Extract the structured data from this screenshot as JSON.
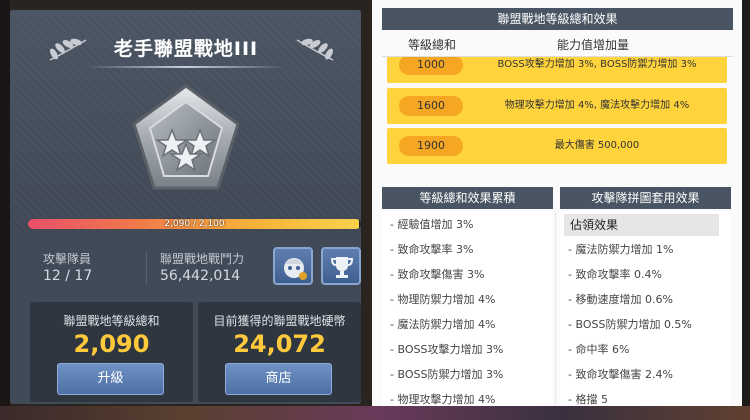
{
  "left_panel": {
    "title": "老手聯盟戰地III",
    "progress": {
      "current": 2090,
      "max": 2100,
      "text": "2,090 / 2,100"
    },
    "attack_team": {
      "label": "攻擊隊員",
      "value": "12 / 17"
    },
    "combat_power": {
      "label": "聯盟戰地戰鬥力",
      "value": "56,442,014"
    },
    "level_total": {
      "label": "聯盟戰地等級總和",
      "value": "2,090",
      "button": "升級"
    },
    "coins": {
      "label": "目前獲得的聯盟戰地硬幣",
      "value": "24,072",
      "button": "商店"
    },
    "icons": [
      "squad-icon",
      "trophy-icon",
      "laurel-icon",
      "pentagon-emblem-icon"
    ]
  },
  "level_effects": {
    "header": "聯盟戰地等級總和效果",
    "col_total": "等級總和",
    "col_effect": "能力值增加量",
    "rows": [
      {
        "level": "1000",
        "effect": "BOSS攻擊力增加 3%, BOSS防禦力增加 3%"
      },
      {
        "level": "1600",
        "effect": "物理攻擊力增加 4%, 魔法攻擊力增加 4%"
      },
      {
        "level": "1900",
        "effect": "最大傷害 500,000"
      }
    ]
  },
  "accumulated": {
    "header": "等級總和效果累積",
    "items": [
      "- 經驗值增加 3%",
      "- 致命攻擊率 3%",
      "- 致命攻擊傷害 3%",
      "- 物理防禦力增加 4%",
      "- 魔法防禦力增加 4%",
      "- BOSS攻擊力增加 3%",
      "- BOSS防禦力增加 3%",
      "- 物理攻擊力增加 4%"
    ]
  },
  "puzzle": {
    "header": "攻擊隊拼圖套用效果",
    "subheader": "佔領效果",
    "items": [
      "- 魔法防禦力增加 1%",
      "- 致命攻擊率 0.4%",
      "- 移動速度增加 0.6%",
      "- BOSS防禦力增加 0.5%",
      "- 命中率 6%",
      "- 致命攻擊傷害 2.4%",
      "- 格擋 5"
    ]
  }
}
